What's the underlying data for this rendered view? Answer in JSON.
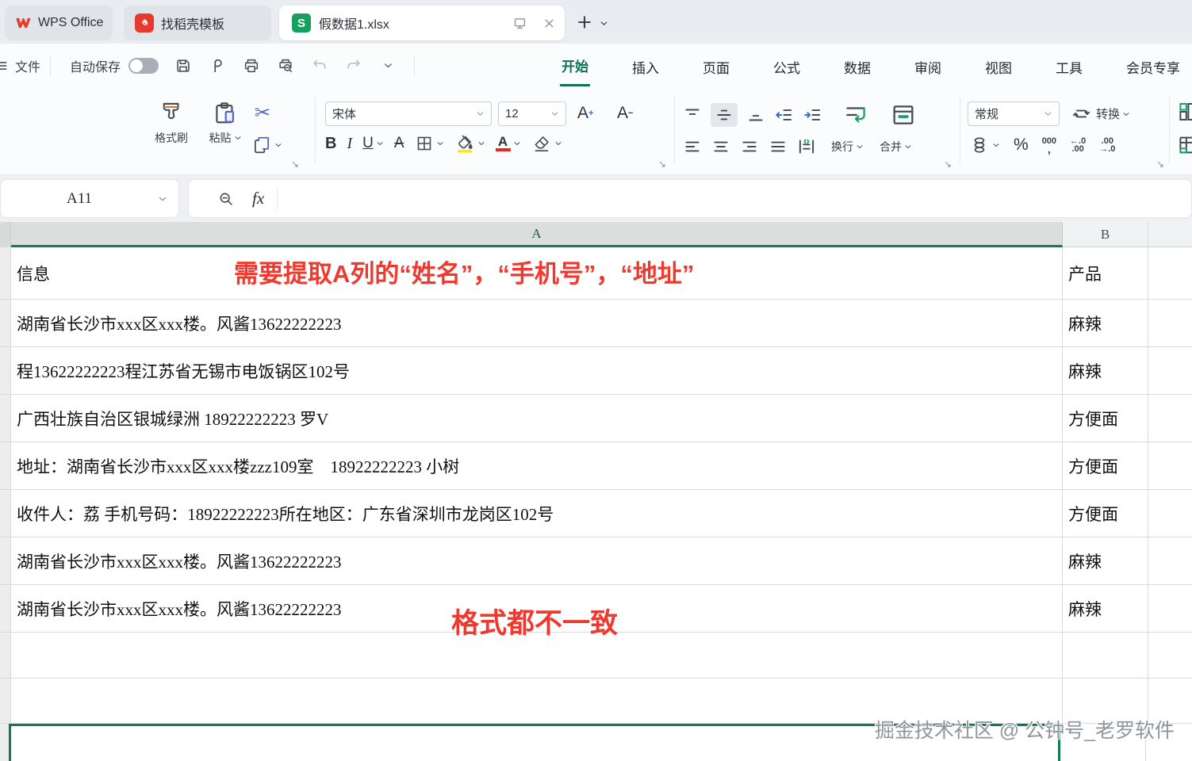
{
  "colors": {
    "accent_green": "#0c7250",
    "selection_green": "#127a52",
    "annotation_red": "#f0392e",
    "highlight_yellow": "#ffe600",
    "font_color_red": "#e8291c",
    "docer_red": "#e8392f",
    "sheet_badge_green": "#16a05d"
  },
  "tabbar": {
    "home_label": "WPS Office",
    "docer_label": "找稻壳模板",
    "doc_label": "假数据1.xlsx",
    "doc_badge": "S"
  },
  "menubar": {
    "file": "文件",
    "autosave": "自动保存",
    "tabs": [
      "开始",
      "插入",
      "页面",
      "公式",
      "数据",
      "审阅",
      "视图",
      "工具",
      "会员专享"
    ]
  },
  "ribbon": {
    "format_painter": "格式刷",
    "paste": "粘贴",
    "cut_glyph": "✂",
    "font_name": "宋体",
    "font_size": "12",
    "grow_letter": "A",
    "grow_sign": "+",
    "shrink_letter": "A",
    "shrink_sign": "−",
    "bold": "B",
    "italic": "I",
    "underline": "U",
    "strike": "A",
    "font_color_letter": "A",
    "wrap_label": "换行",
    "merge_label": "合并",
    "number_format_value": "常规",
    "convert_label": "转换",
    "percent": "%",
    "thousands_top": "000",
    "thousands_bottom": ",",
    "dec_decrease_top": "←.0",
    "dec_decrease_bottom": ".00",
    "dec_increase_top": ".00",
    "dec_increase_bottom": "→.0",
    "launcher_glyph": "↘"
  },
  "formula_bar": {
    "cell_ref": "A11",
    "fx": "fx"
  },
  "sheet": {
    "col_a": "A",
    "col_b": "B",
    "rows": [
      {
        "a": "信息",
        "b": "产品"
      },
      {
        "a": "湖南省长沙市xxx区xxx楼。风酱13622222223",
        "b": "麻辣"
      },
      {
        "a": "程13622222223程江苏省无锡市电饭锅区102号",
        "b": "麻辣"
      },
      {
        "a": "广西壮族自治区银城绿洲 18922222223 罗V",
        "b": "方便面"
      },
      {
        "a": "地址：湖南省长沙市xxx区xxx楼zzz109室    18922222223 小树",
        "b": "方便面"
      },
      {
        "a": "收件人：荔 手机号码：18922222223所在地区：广东省深圳市龙岗区102号",
        "b": "方便面"
      },
      {
        "a": "湖南省长沙市xxx区xxx楼。风酱13622222223",
        "b": "麻辣"
      },
      {
        "a": "湖南省长沙市xxx区xxx楼。风酱13622222223",
        "b": "麻辣"
      },
      {
        "a": "",
        "b": ""
      },
      {
        "a": "",
        "b": ""
      },
      {
        "a": "",
        "b": ""
      }
    ],
    "annotation_top": "需要提取A列的“姓名”，“手机号”，“地址”",
    "annotation_bottom": "格式都不一致",
    "watermark": "掘金技术社区 @ 公钟号_老罗软件"
  }
}
